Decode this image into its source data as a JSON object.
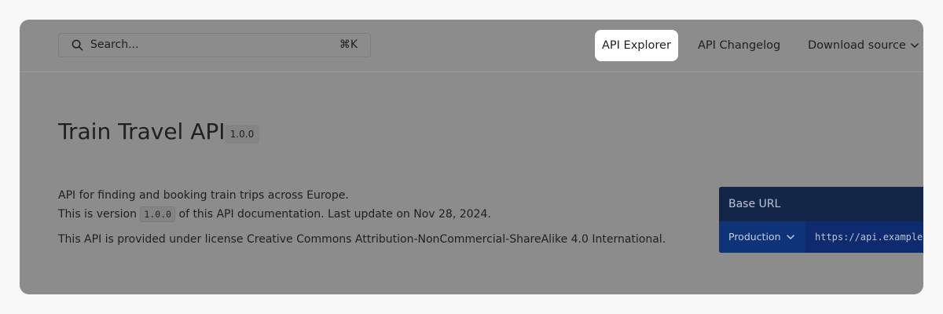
{
  "header": {
    "search": {
      "placeholder": "Search...",
      "shortcut": "⌘K"
    },
    "nav": {
      "api_explorer": "API Explorer",
      "api_changelog": "API Changelog",
      "download_source": "Download source"
    }
  },
  "main": {
    "title": "Train Travel API",
    "version": "1.0.0",
    "description_line1": "API for finding and booking train trips across Europe.",
    "description_line2_pre": "This is version ",
    "description_line2_version": "1.0.0",
    "description_line2_post": " of this API documentation. Last update on Nov 28, 2024.",
    "license": "This API is provided under license Creative Commons Attribution-NonCommercial-ShareAlike 4.0 International."
  },
  "base_url": {
    "label": "Base URL",
    "environment": "Production",
    "url": "https://api.example"
  },
  "colors": {
    "overlay_gray": "#8c8c8c",
    "active_nav_bg": "#ffffff",
    "base_url_header": "#132648",
    "base_url_row": "#0f3379"
  }
}
